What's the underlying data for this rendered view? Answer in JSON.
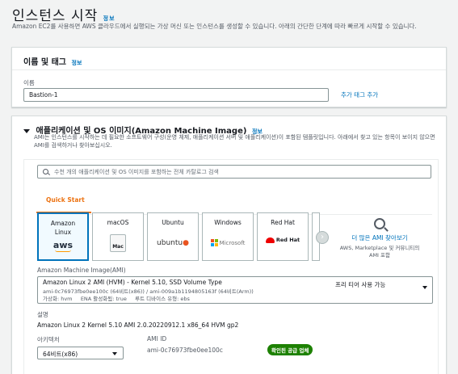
{
  "page": {
    "title": "인스턴스 시작",
    "info": "정보",
    "description": "Amazon EC2를 사용하면 AWS 클라우드에서 실행되는 가상 머신 또는 인스턴스를 생성할 수 있습니다. 아래의 간단한 단계에 따라 빠르게 시작할 수 있습니다."
  },
  "name_tags": {
    "heading": "이름 및 태그",
    "info": "정보",
    "name_label": "이름",
    "name_value": "Bastion-1",
    "add_tags": "추가 태그 추가"
  },
  "ami": {
    "heading": "애플리케이션 및 OS 이미지(Amazon Machine Image)",
    "info": "정보",
    "description": "AMI는 인스턴스를 시작하는 데 필요한 소프트웨어 구성(운영 체제, 애플리케이션 서버 및 애플리케이션)이 포함된 템플릿입니다. 아래에서 찾고 있는 항목이 보이지 않으면 AMI를 검색하거나 찾아보십시오.",
    "search_placeholder": "수천 개의 애플리케이션 및 OS 이미지를 포함하는 전체 카탈로그 검색",
    "tab_quick_start": "Quick Start",
    "tiles": [
      {
        "name": "Amazon Linux",
        "logo": "aws"
      },
      {
        "name": "macOS",
        "logo": "Mac"
      },
      {
        "name": "Ubuntu",
        "logo": "ubuntu"
      },
      {
        "name": "Windows",
        "logo": "Microsoft"
      },
      {
        "name": "Red Hat",
        "logo": "Red Hat"
      }
    ],
    "browse_more": "더 많은 AMI 찾아보기",
    "browse_sub": "AWS, Marketplace 및 커뮤니티의 AMI 포함",
    "ami_label": "Amazon Machine Image(AMI)",
    "ami_title": "Amazon Linux 2 AMI (HVM) - Kernel 5.10, SSD Volume Type",
    "ami_ids": "ami-0c76973fbe0ee100c (64비트(x86)) / ami-009a1b1194805163f (64비트(Arm))",
    "ami_meta": "가상화: hvm     ENA 활성화됨: true     루트 디바이스 유형: ebs",
    "free_tier": "프리 티어 사용 가능",
    "desc_label": "설명",
    "desc_value": "Amazon Linux 2 Kernel 5.10 AMI 2.0.20220912.1 x86_64 HVM gp2",
    "arch_label": "아키텍처",
    "arch_value": "64비트(x86)",
    "amiid_label": "AMI ID",
    "amiid_value": "ami-0c76973fbe0ee100c",
    "verified": "확인된 공급 업체"
  }
}
